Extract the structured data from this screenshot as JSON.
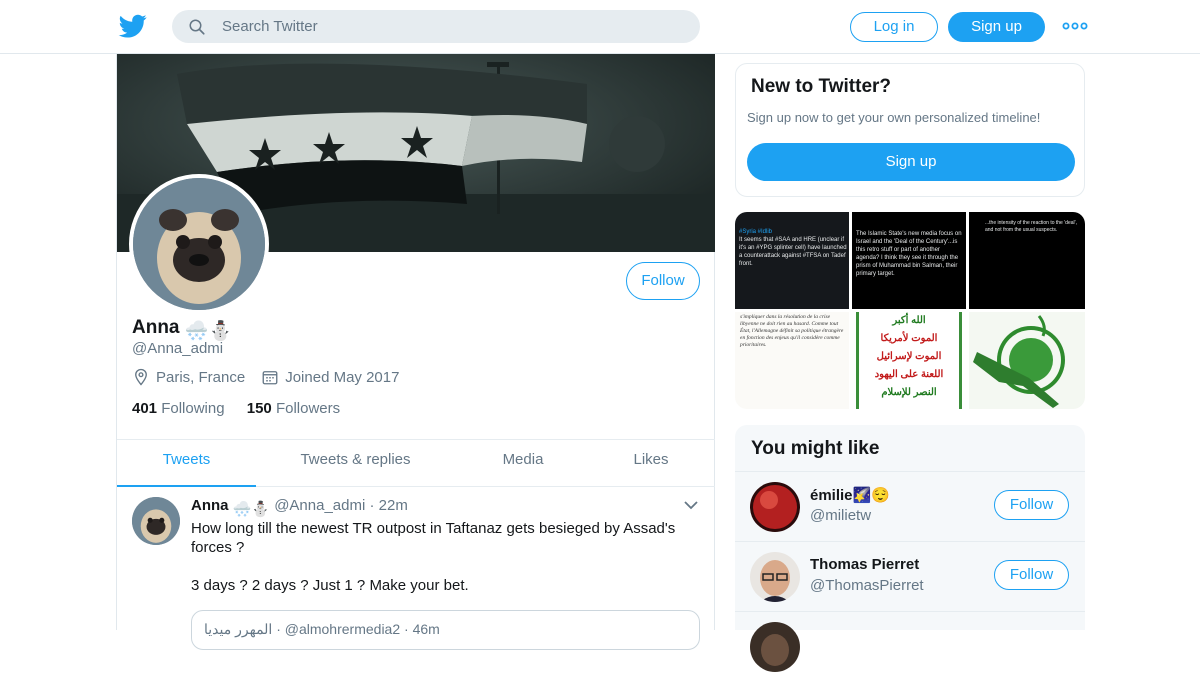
{
  "header": {
    "search_placeholder": "Search Twitter",
    "login_label": "Log in",
    "signup_label": "Sign up"
  },
  "profile": {
    "follow_label": "Follow",
    "name": "Anna",
    "name_emoji": "🌨️⛄",
    "handle": "@Anna_admi",
    "location": "Paris, France",
    "joined": "Joined May 2017",
    "following_count": "401",
    "following_label": "Following",
    "followers_count": "150",
    "followers_label": "Followers"
  },
  "tabs": [
    "Tweets",
    "Tweets & replies",
    "Media",
    "Likes"
  ],
  "tweet": {
    "name": "Anna",
    "name_emoji": "🌨️⛄",
    "handle": "@Anna_admi",
    "time": "22m",
    "text": "How long till the newest TR outpost in Taftanaz gets besieged by Assad's forces ?",
    "text2": "3 days ? 2 days ? Just 1 ? Make your bet.",
    "quote_header": "المهرر ميديا · @almohrermedia2 · 46m"
  },
  "new_to_twitter": {
    "title": "New to Twitter?",
    "subtitle": "Sign up now to get your own personalized timeline!",
    "signup_label": "Sign up"
  },
  "media_grid": {
    "tweet1_tags": "#Syria #Idlib",
    "tweet1_text": "It seems that #SAA and HRE (unclear if it's an #YPG splinter cell) have launched a counterattack against #TFSA on Tadef front.",
    "tweet2_text": "The Islamic State's new media focus on Israel and the 'Deal of the Century'...is this retro stuff or part of another agenda? I think they see it through the prism of Muhammad bin Salman, their primary target.",
    "tweet3_text": "...the intensity of the reaction to the 'deal', and not from the usual suspects.",
    "doc_text": "s'impliquer dans la résolution de la crise libyenne ne doit rien au hasard. Comme tout État, l'Allemagne définit sa politique étrangère en fonction des enjeux qu'il considère comme prioritaires.",
    "slogan_lines": [
      "الله أكبر",
      "الموت لأمريكا",
      "الموت لإسرائيل",
      "اللعنة على اليهود",
      "النصر للإسلام"
    ]
  },
  "you_might_like": {
    "title": "You might like",
    "people": [
      {
        "name": "émilie",
        "name_emoji": "🌠😌",
        "handle": "@milietw",
        "follow_label": "Follow"
      },
      {
        "name": "Thomas Pierret",
        "name_emoji": "",
        "handle": "@ThomasPierret",
        "follow_label": "Follow"
      }
    ]
  },
  "colors": {
    "accent": "#1da1f2",
    "text": "#14171a",
    "muted": "#657786"
  }
}
